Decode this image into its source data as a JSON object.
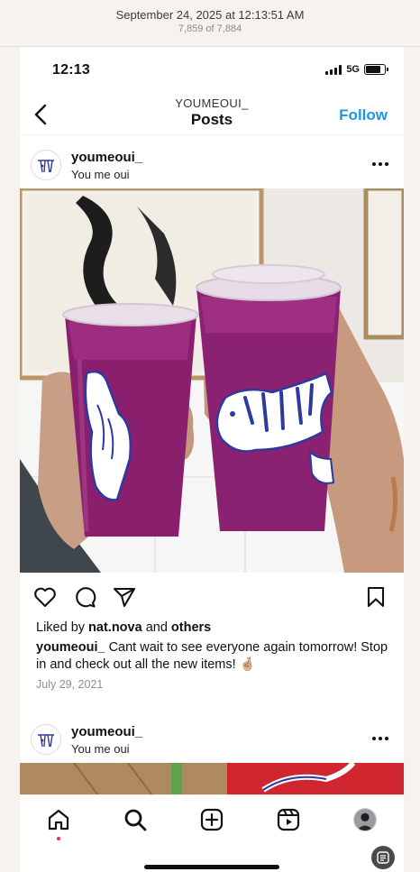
{
  "viewer": {
    "title": "September 24, 2025 at 12:13:51 AM",
    "counter": "7,859 of 7,884"
  },
  "status_bar": {
    "time": "12:13",
    "network": "5G"
  },
  "nav": {
    "username": "YOUMEOUI_",
    "title": "Posts",
    "follow_label": "Follow",
    "back_icon": "chevron-left-icon"
  },
  "posts": [
    {
      "username": "youmeoui_",
      "subtitle": "You me oui",
      "likes_prefix": "Liked by ",
      "likes_user": "nat.nova",
      "likes_mid": " and ",
      "likes_suffix": "others",
      "caption_user": "youmeoui_",
      "caption_text": " Cant wait to see everyone again tomorrow! Stop in and check out all the new items! 🤞🏼",
      "date": "July 29, 2021"
    },
    {
      "username": "youmeoui_",
      "subtitle": "You me oui"
    }
  ],
  "actions": {
    "like_icon": "heart-icon",
    "comment_icon": "comment-icon",
    "share_icon": "send-icon",
    "save_icon": "bookmark-icon"
  },
  "tab_bar": {
    "items": [
      "home-icon",
      "search-icon",
      "new-post-icon",
      "reels-icon",
      "profile-avatar"
    ]
  },
  "colors": {
    "accent": "#1a96ec",
    "drink": "#8a1f6e",
    "illustration": "#2c3a9e",
    "notification": "#ff2f40"
  }
}
